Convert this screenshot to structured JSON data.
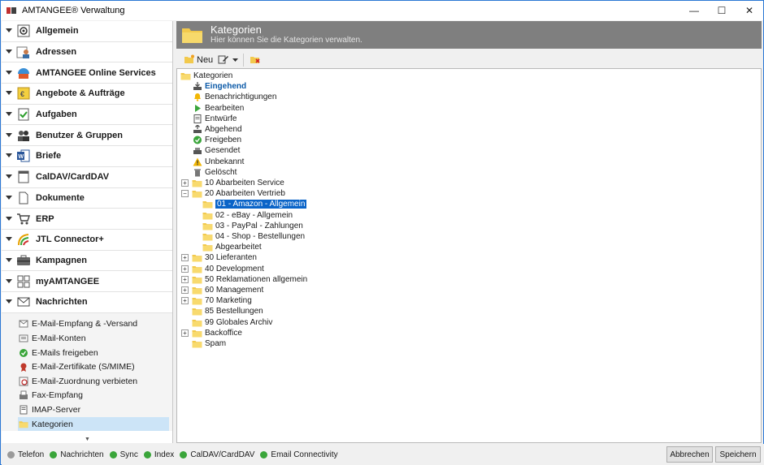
{
  "window": {
    "title": "AMTANGEE® Verwaltung",
    "minimize": "—",
    "maximize": "☐",
    "close": "✕"
  },
  "sidebar": {
    "items": [
      {
        "label": "Allgemein",
        "icon": "general-icon"
      },
      {
        "label": "Adressen",
        "icon": "addresses-icon"
      },
      {
        "label": "AMTANGEE Online Services",
        "icon": "online-services-icon"
      },
      {
        "label": "Angebote & Aufträge",
        "icon": "offers-icon"
      },
      {
        "label": "Aufgaben",
        "icon": "tasks-icon"
      },
      {
        "label": "Benutzer & Gruppen",
        "icon": "users-icon"
      },
      {
        "label": "Briefe",
        "icon": "letters-icon"
      },
      {
        "label": "CalDAV/CardDAV",
        "icon": "caldav-icon"
      },
      {
        "label": "Dokumente",
        "icon": "documents-icon"
      },
      {
        "label": "ERP",
        "icon": "erp-icon"
      },
      {
        "label": "JTL Connector+",
        "icon": "jtl-icon"
      },
      {
        "label": "Kampagnen",
        "icon": "campaigns-icon"
      },
      {
        "label": "myAMTANGEE",
        "icon": "myamtangee-icon"
      },
      {
        "label": "Nachrichten",
        "icon": "messages-icon"
      }
    ],
    "sub_items": [
      {
        "label": "E-Mail-Empfang & -Versand",
        "icon": "email-send-icon"
      },
      {
        "label": "E-Mail-Konten",
        "icon": "email-accounts-icon"
      },
      {
        "label": "E-Mails freigeben",
        "icon": "check-icon"
      },
      {
        "label": "E-Mail-Zertifikate (S/MIME)",
        "icon": "certificate-icon"
      },
      {
        "label": "E-Mail-Zuordnung verbieten",
        "icon": "forbid-icon"
      },
      {
        "label": "Fax-Empfang",
        "icon": "fax-icon"
      },
      {
        "label": "IMAP-Server",
        "icon": "imap-icon"
      },
      {
        "label": "Kategorien",
        "icon": "folder-icon"
      }
    ]
  },
  "header": {
    "title": "Kategorien",
    "subtitle": "Hier können Sie die Kategorien verwalten."
  },
  "toolbar": {
    "new_label": "Neu"
  },
  "tree": {
    "root": "Kategorien",
    "system": [
      "Eingehend",
      "Benachrichtigungen",
      "Bearbeiten",
      "Entwürfe",
      "Abgehend",
      "Freigeben",
      "Gesendet",
      "Unbekannt",
      "Gelöscht"
    ],
    "folders": [
      "10 Abarbeiten Service",
      "20 Abarbeiten Vertrieb",
      "01 - Amazon - Allgemein",
      "02 - eBay - Allgemein",
      "03 - PayPal - Zahlungen",
      "04 - Shop - Bestellungen",
      "Abgearbeitet",
      "30 Lieferanten",
      "40 Development",
      "50 Reklamationen allgemein",
      "60 Management",
      "70 Marketing",
      "85 Bestellungen",
      "99 Globales Archiv",
      "Backoffice",
      "Spam"
    ]
  },
  "status": {
    "items": [
      "Telefon",
      "Nachrichten",
      "Sync",
      "Index",
      "CalDAV/CardDAV",
      "Email Connectivity"
    ],
    "colors": [
      "#9a9a9a",
      "#3aa53a",
      "#3aa53a",
      "#3aa53a",
      "#3aa53a",
      "#3aa53a"
    ]
  },
  "buttons": {
    "cancel": "Abbrechen",
    "save": "Speichern"
  }
}
